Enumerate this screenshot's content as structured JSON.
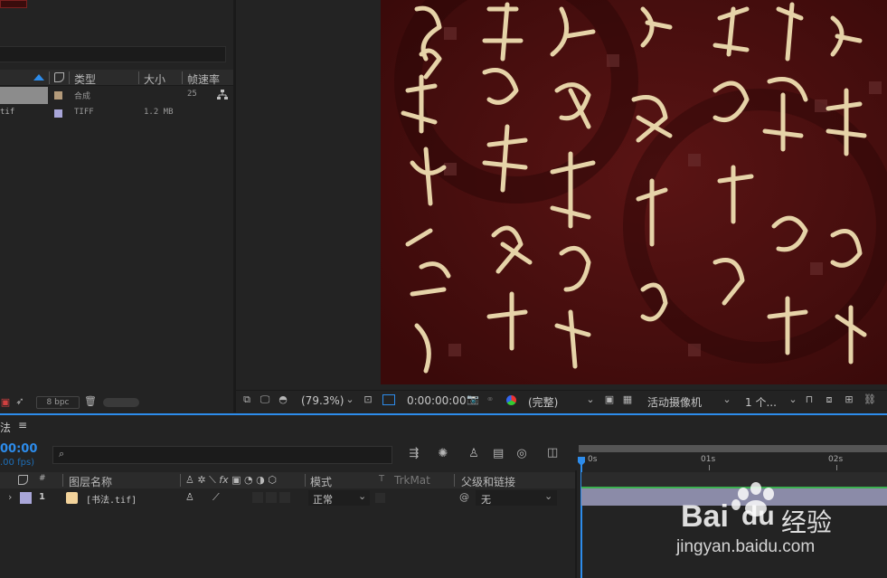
{
  "project": {
    "columns": {
      "type": "类型",
      "size": "大小",
      "fps": "帧速率"
    },
    "items": [
      {
        "type": "合成",
        "size": "",
        "fps": "25",
        "color": "#b39a7a"
      },
      {
        "name_fragment": "tif",
        "type": "TIFF",
        "size": "1.2 MB",
        "fps": "",
        "color": "#a9a6d9"
      }
    ],
    "bpc": "8 bpc"
  },
  "viewer": {
    "zoom": "(79.3%)",
    "timecode": "0:00:00:00",
    "quality": "(完整)",
    "camera": "活动摄像机",
    "views": "1 个..."
  },
  "timeline": {
    "tab_name": "法",
    "timecode": "00:00",
    "fps": ".00 fps)",
    "columns": {
      "num": "#",
      "layer_name": "图层名称",
      "mode": "模式",
      "t": "T",
      "trkmat": "TrkMat",
      "parent": "父级和链接"
    },
    "layer": {
      "index": "1",
      "name": "[书法.tif]",
      "mode": "正常",
      "parent": "无",
      "label_color": "#a9a6d9"
    },
    "ruler": [
      "0s",
      "01s",
      "02s"
    ]
  },
  "watermark": {
    "brand": "Bai",
    "brand2": "du",
    "product": "经验",
    "url": "jingyan.baidu.com"
  },
  "colors": {
    "accent": "#2d8ceb",
    "canvas": "#4a1010",
    "calligraphy": "#e6d3a8",
    "track": "#8b8ba8"
  }
}
